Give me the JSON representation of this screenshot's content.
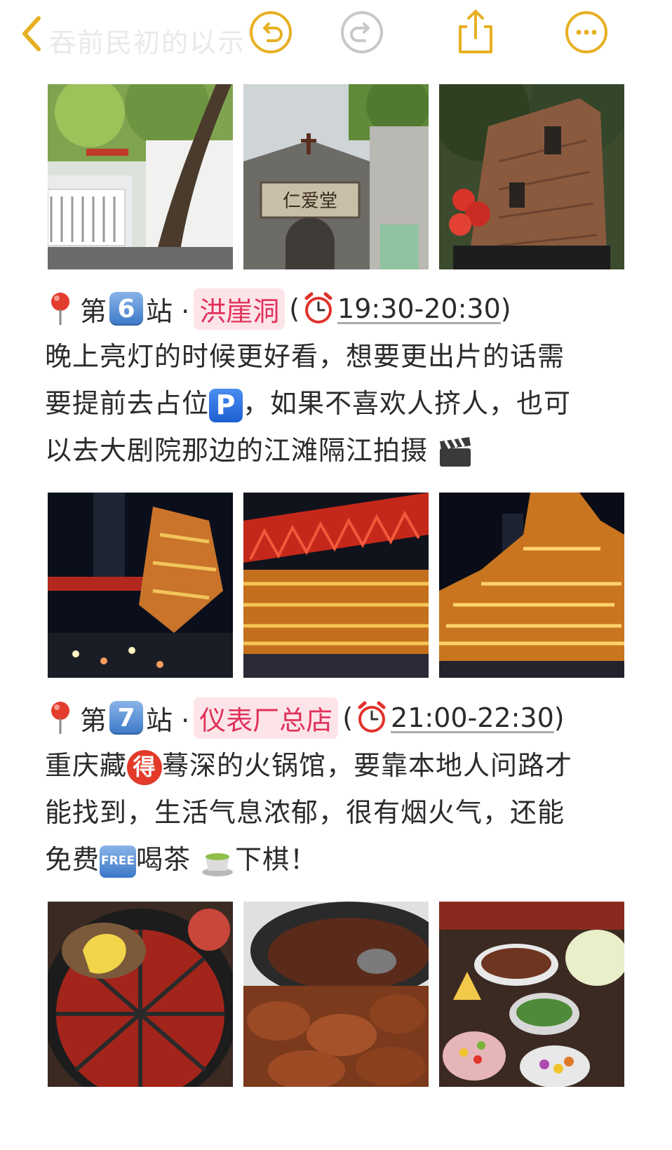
{
  "header": {
    "title_faded": "吞前民初的以示"
  },
  "stops": [
    {
      "prefix": "第",
      "number": "6",
      "suffix": "站 ·",
      "place": "洪崖洞",
      "open_paren": "(",
      "time": "19:30-20:30",
      "close_paren": ")",
      "lines": [
        "晚上亮灯的时候更好看，想要更出片的话需",
        "要提前去占位",
        "，如果不喜欢人挤人，也可",
        "以去大剧院那边的江滩隔江拍摄"
      ],
      "parking_emoji": "P"
    },
    {
      "prefix": "第",
      "number": "7",
      "suffix": "站 ·",
      "place": "仪表厂总店",
      "open_paren": "(",
      "time": "21:00-22:30",
      "close_paren": ")",
      "lines": [
        "重庆藏",
        "蓦深的火锅馆，要靠本地人问路才",
        "能找到，生活气息浓郁，很有烟火气，还能",
        "免费",
        "喝茶",
        "下棋！"
      ],
      "de_emoji": "得",
      "free_emoji": "FREE"
    }
  ],
  "photos": {
    "row1": [
      "alley-street-photo",
      "church-renaitang-photo",
      "brick-building-photo"
    ],
    "row1_sign_text": "仁爱堂",
    "row2": [
      "hongyadong-night-street-photo",
      "hongyadong-bridge-photo",
      "hongyadong-lit-building-photo"
    ],
    "row3": [
      "hotpot-tofu-skin-photo",
      "braised-pork-trotters-photo",
      "hotpot-dishes-photo"
    ]
  },
  "colors": {
    "accent": "#E6B022",
    "tag_bg": "#FDE4E8",
    "tag_text": "#E0315A",
    "badge_blue": "#3B78C8"
  }
}
